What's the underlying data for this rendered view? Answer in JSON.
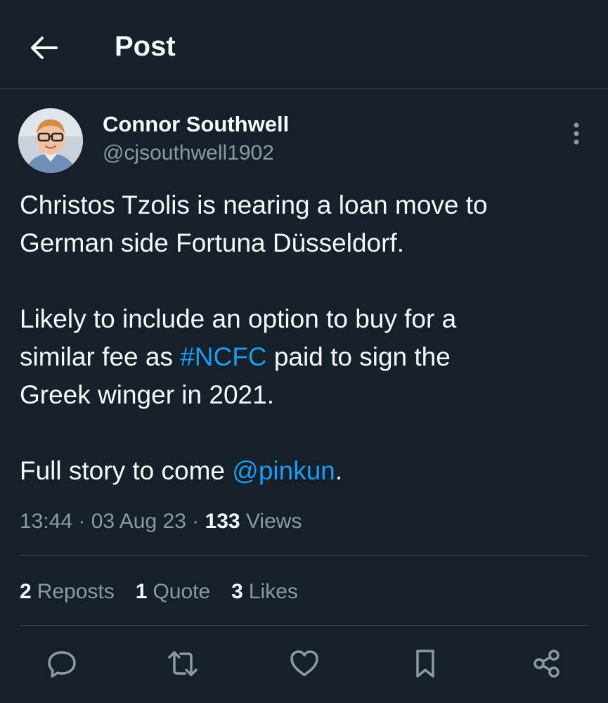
{
  "header": {
    "title": "Post",
    "back_icon": "arrow-left-icon"
  },
  "post": {
    "author": {
      "name": "Connor Southwell",
      "handle": "@cjsouthwell1902"
    },
    "text": {
      "p1_line1": "Christos Tzolis is nearing a loan move to",
      "p1_line2": "German side Fortuna Düsseldorf.",
      "p2_line1": "Likely to include an option to buy for a",
      "p2_line2a": "similar fee as ",
      "p2_hashtag": "#NCFC",
      "p2_line2b": " paid to sign the",
      "p2_line3": "Greek winger in 2021.",
      "p3_a": "Full story to come ",
      "p3_mention": "@pinkun",
      "p3_b": "."
    },
    "meta": {
      "time": "13:44",
      "sep1": " · ",
      "date": "03 Aug 23",
      "sep2": " · ",
      "views_count": "133",
      "views_label": " Views"
    },
    "stats": {
      "reposts_count": "2",
      "reposts_label": "Reposts",
      "quotes_count": "1",
      "quotes_label": "Quote",
      "likes_count": "3",
      "likes_label": "Likes"
    }
  },
  "actions": [
    "reply-icon",
    "repost-icon",
    "like-icon",
    "bookmark-icon",
    "share-icon"
  ],
  "colors": {
    "background": "#15202b",
    "link": "#1d9bf0",
    "secondary_text": "#8b98a5",
    "divider": "#38444d"
  }
}
